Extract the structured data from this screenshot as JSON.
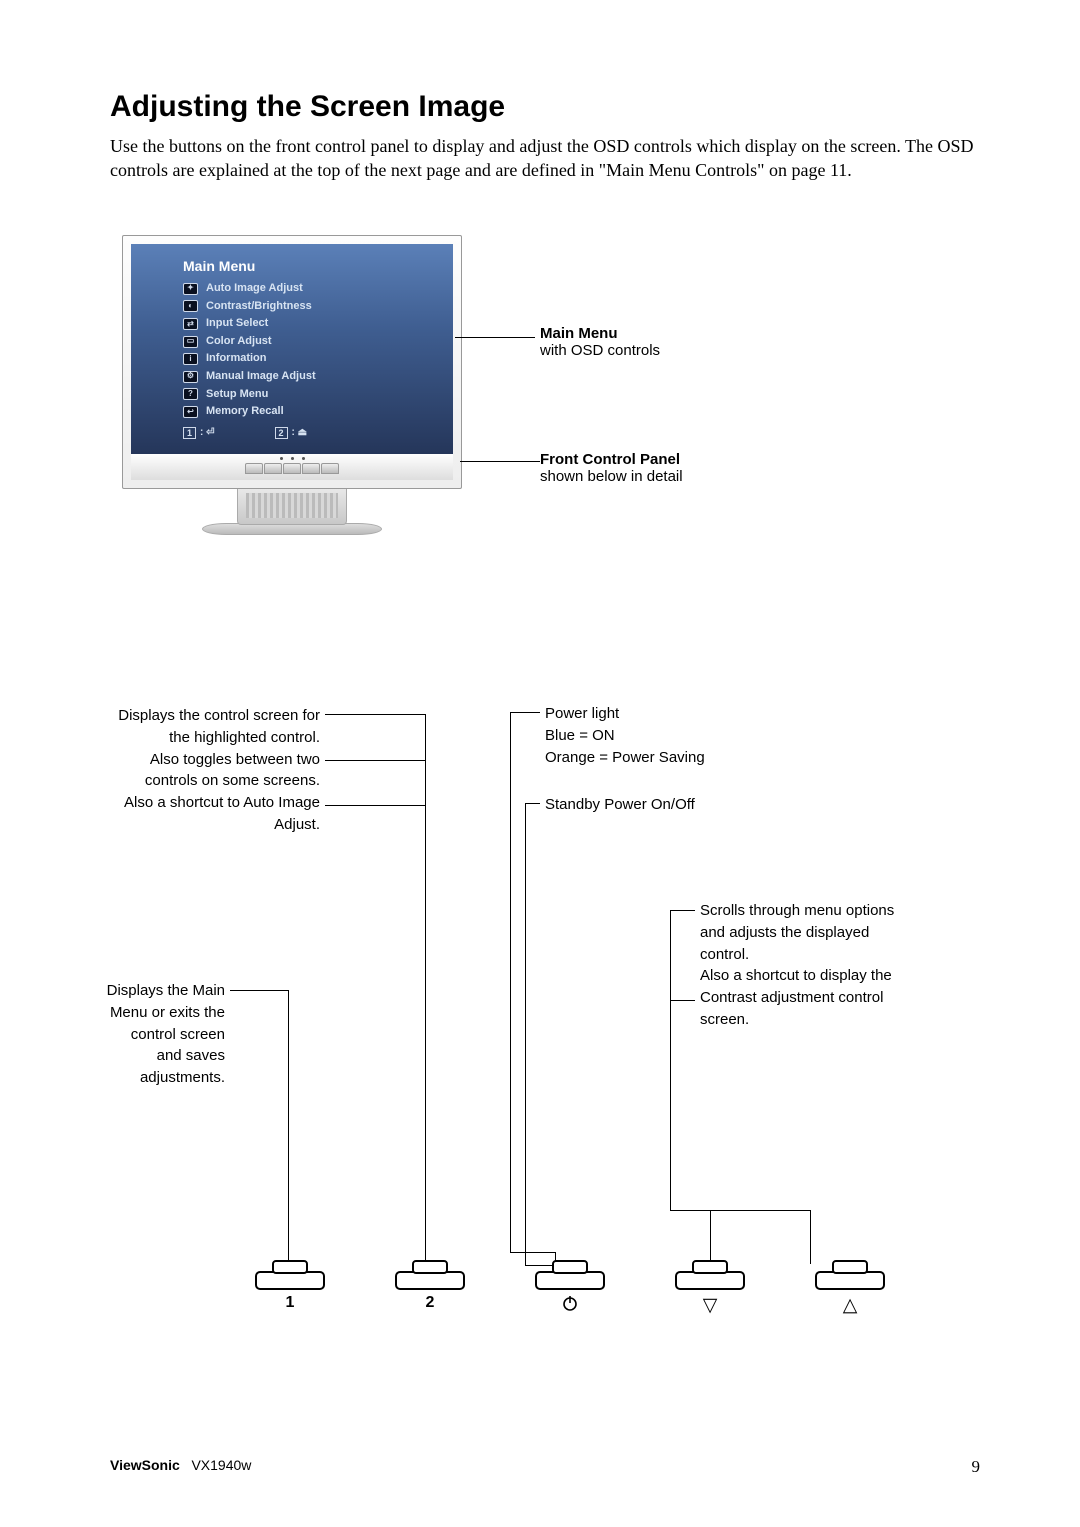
{
  "heading": "Adjusting the Screen Image",
  "intro": "Use the buttons on the front control panel to display and adjust the OSD controls which display on the screen. The OSD controls are explained at the top of the next page and are defined in \"Main Menu Controls\" on page 11.",
  "osd": {
    "title": "Main Menu",
    "items": [
      "Auto Image Adjust",
      "Contrast/Brightness",
      "Input Select",
      "Color Adjust",
      "Information",
      "Manual Image Adjust",
      "Setup Menu",
      "Memory Recall"
    ],
    "footer1": "1",
    "footer2": "2"
  },
  "callouts": {
    "main_title": "Main Menu",
    "main_sub": "with OSD controls",
    "front_title": "Front Control Panel",
    "front_sub": "shown below in detail"
  },
  "diagram": {
    "lt1_a": "Displays the control screen for the highlighted control.",
    "lt1_b": "Also toggles between two controls on some screens.",
    "lt1_c": "Also a shortcut to Auto Image Adjust.",
    "lt2": "Displays the Main Menu or exits the control screen and saves adjustments.",
    "rt1_a": "Power light",
    "rt1_b": "Blue = ON",
    "rt1_c": "Orange = Power Saving",
    "rt2": "Standby Power On/Off",
    "rt3_a": "Scrolls through menu options and adjusts the displayed control.",
    "rt3_b": "Also a shortcut to display the Contrast adjustment control screen."
  },
  "buttons": {
    "b1": "1",
    "b2": "2",
    "b3": "⏻",
    "b4": "▽",
    "b5": "△"
  },
  "footer": {
    "brand": "ViewSonic",
    "model": "VX1940w",
    "page": "9"
  }
}
